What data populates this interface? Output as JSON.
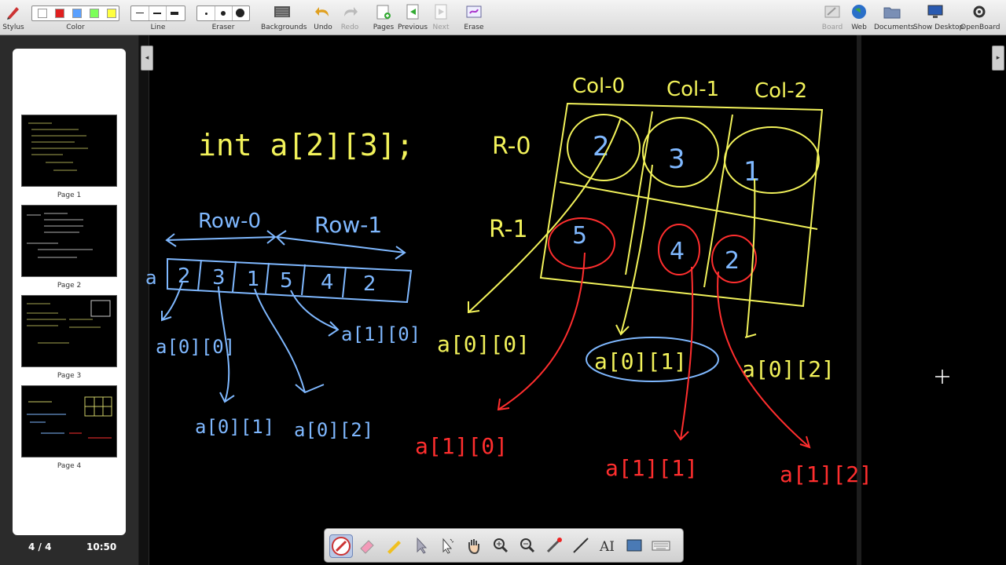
{
  "toolbar": {
    "stylus": "Stylus",
    "color": "Color",
    "line": "Line",
    "eraser": "Eraser",
    "backgrounds": "Backgrounds",
    "undo": "Undo",
    "redo": "Redo",
    "pages": "Pages",
    "previous": "Previous",
    "next": "Next",
    "erase": "Erase",
    "board": "Board",
    "web": "Web",
    "documents": "Documents",
    "show_desktop": "Show Desktop",
    "openboard": "OpenBoard",
    "colors": [
      "#ffffff",
      "#e02020",
      "#5aa0ff",
      "#7cff5a",
      "#ffff40"
    ]
  },
  "sidebar": {
    "pages": [
      {
        "label": "Page 1"
      },
      {
        "label": "Page 2"
      },
      {
        "label": "Page 3"
      },
      {
        "label": "Page 4"
      }
    ],
    "page_count": "4 / 4",
    "clock": "10:50"
  },
  "board": {
    "declaration": "int a[2][3];",
    "row0": "Row-0",
    "row1": "Row-1",
    "array_name": "a",
    "array_values": [
      "2",
      "3",
      "1",
      "5",
      "4",
      "2"
    ],
    "left_labels": [
      "a[0][0]",
      "a[1][0]",
      "a[0][1]",
      "a[0][2]"
    ],
    "col_headers": [
      "Col-0",
      "Col-1",
      "Col-2"
    ],
    "row_headers": [
      "R-0",
      "R-1"
    ],
    "grid_row0": [
      "2",
      "3",
      "1"
    ],
    "grid_row1": [
      "5",
      "4",
      "2"
    ],
    "right_labels_yellow": [
      "a[0][0]",
      "a[0][1]",
      "a[0][2]"
    ],
    "right_labels_red": [
      "a[1][0]",
      "a[1][1]",
      "a[1][2]"
    ],
    "colors": {
      "yellow": "#f2f25a",
      "blue": "#7fb8ff",
      "red": "#ff2e2e"
    }
  },
  "palette": {
    "tools": [
      "pen-icon",
      "eraser-icon",
      "marker-icon",
      "selector-icon",
      "play-icon",
      "hand-icon",
      "zoom-in-icon",
      "zoom-out-icon",
      "laser-icon",
      "line-icon",
      "text-icon",
      "capture-icon",
      "keyboard-icon"
    ]
  }
}
